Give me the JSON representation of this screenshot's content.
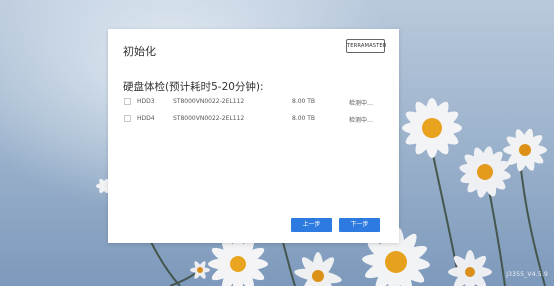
{
  "background": {
    "version_label": "J3355_V4.5.9"
  },
  "dialog": {
    "title": "初始化",
    "logo_text": "TERRAMASTER",
    "section_title": "硬盘体检(预计耗时5-20分钟):",
    "disks": [
      {
        "name": "HDD3",
        "model": "ST8000VN0022-2EL112",
        "size": "8.00 TB",
        "status": "检测中…",
        "checked": false
      },
      {
        "name": "HDD4",
        "model": "ST8000VN0022-2EL112",
        "size": "8.00 TB",
        "status": "检测中…",
        "checked": false
      }
    ],
    "prev_label": "上一步",
    "next_label": "下一步"
  },
  "colors": {
    "accent": "#2d7ae0"
  }
}
